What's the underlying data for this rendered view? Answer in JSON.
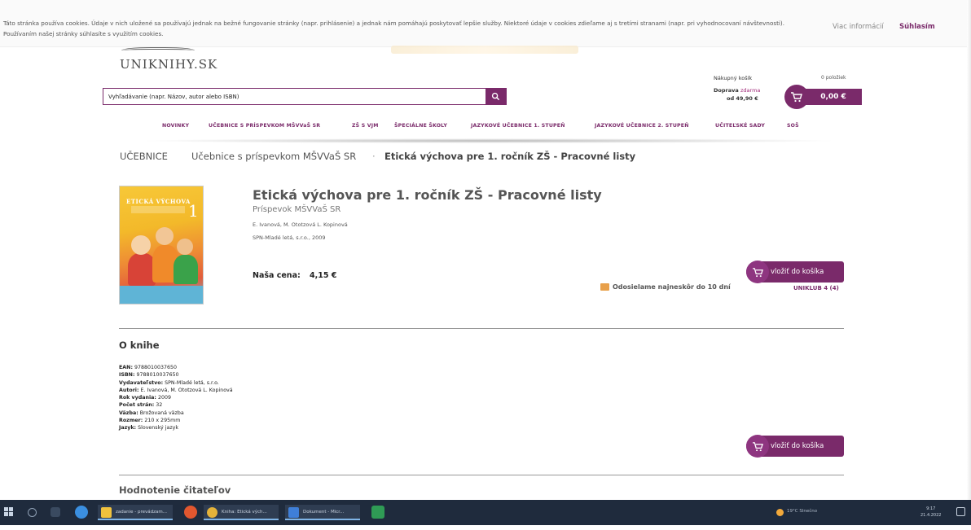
{
  "cookie_bar": {
    "text": "Táto stránka používa cookies. Údaje v nich uložené sa používajú jednak na bežné fungovanie stránky (napr. prihlásenie) a jednak nám pomáhajú poskytovať lepšie služby. Niektoré údaje v cookies zdieľame aj s tretími stranami (napr. pri vyhodnocovaní návštevnosti). Používaním našej stránky súhlasíte s využitím cookies.",
    "more_label": "Viac informácií",
    "accept_label": "Súhlasím"
  },
  "header": {
    "logo_text": "UNIKNIHY.SK",
    "search_placeholder": "Vyhľadávanie (napr. Názov, autor alebo ISBN)"
  },
  "cart": {
    "title": "Nákupný košík",
    "items": "0 položiek",
    "free_shipping_label": "Doprava",
    "free_shipping_value": "zdarma",
    "free_shipping_limit": "od 49,90 €",
    "total": "0,00 €"
  },
  "nav": [
    "NOVINKY",
    "UČEBNICE S PRÍSPEVKOM MŠVVaŠ SR",
    "ZŠ S VJM",
    "ŠPECIÁLNE ŠKOLY",
    "JAZYKOVÉ UČEBNICE 1. STUPEŇ",
    "JAZYKOVÉ UČEBNICE 2. STUPEŇ",
    "UČITEĽSKÉ SADY",
    "SOŠ"
  ],
  "breadcrumb": {
    "level1": "UČEBNICE",
    "level2": "Učebnice s príspevkom MŠVVaŠ SR",
    "separator": "·",
    "level3": "Etická výchova pre 1. ročník ZŠ - Pracovné listy"
  },
  "product": {
    "cover_title": "ETICKÁ VÝCHOVA",
    "cover_number": "1",
    "title": "Etická výchova pre 1. ročník ZŠ - Pracovné listy",
    "subtitle": "Príspevok MŠVVaŠ SR",
    "authors": "E. Ivanová, M. Ototzová L. Kopinová",
    "publisher_year": "SPN-Mladé letá, s.r.o., 2009",
    "price_label": "Naša cena:",
    "price": "4,15 €",
    "add_to_cart": "vložiť do košíka",
    "shipping": "Odosielame najneskôr do 10 dní",
    "uniklub": "UNIKLUB 4 (4)"
  },
  "about": {
    "title": "O knihe",
    "details": [
      {
        "label": "EAN:",
        "value": "9788010037650"
      },
      {
        "label": "ISBN:",
        "value": "9788010037650"
      },
      {
        "label": "Vydavateľstvo:",
        "value": "SPN-Mladé letá, s.r.o."
      },
      {
        "label": "Autori:",
        "value": "E. Ivanová, M. Ototzová L. Kopinová"
      },
      {
        "label": "Rok vydania:",
        "value": "2009"
      },
      {
        "label": "Počet strán:",
        "value": "32"
      },
      {
        "label": "Väzba:",
        "value": "Brožovaná väzba"
      },
      {
        "label": "Rozmer:",
        "value": "210 x 295mm"
      },
      {
        "label": "Jazyk:",
        "value": "Slovenský jazyk"
      }
    ],
    "add_to_cart": "vložiť do košíka"
  },
  "reviews": {
    "title": "Hodnotenie čitateľov"
  },
  "taskbar": {
    "app1": "zadanie - prevádzam...",
    "app2": "Kniha: Etická vých...",
    "app3": "Dokument - Micr...",
    "tray_text": "19°C Slnečno",
    "clock_time": "9:17",
    "clock_date": "21.4.2022"
  },
  "colors": {
    "accent": "#7a2a6a",
    "taskbar": "#1f2b3d"
  }
}
